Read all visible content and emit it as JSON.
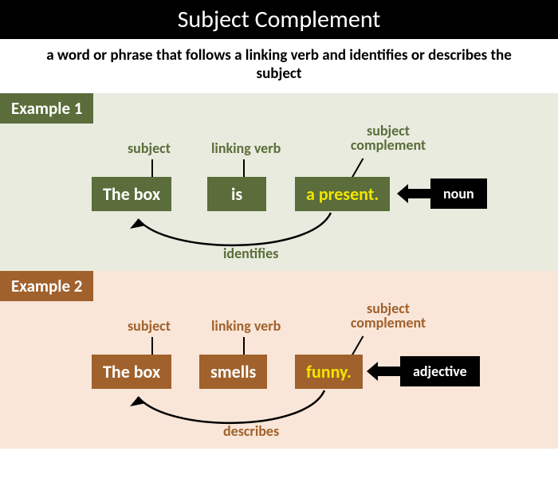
{
  "title": "Subject Complement",
  "definition": "a word or phrase that follows a linking verb and identifies or describes the subject",
  "example1": {
    "tab": "Example 1",
    "labels": {
      "subject": "subject",
      "linking_verb": "linking verb",
      "complement_l1": "subject",
      "complement_l2": "complement"
    },
    "words": {
      "subject": "The box",
      "verb": "is",
      "complement": "a present."
    },
    "type": "noun",
    "relation": "identifies"
  },
  "example2": {
    "tab": "Example 2",
    "labels": {
      "subject": "subject",
      "linking_verb": "linking verb",
      "complement_l1": "subject",
      "complement_l2": "complement"
    },
    "words": {
      "subject": "The box",
      "verb": "smells",
      "complement": "funny."
    },
    "type": "adjective",
    "relation": "describes"
  }
}
